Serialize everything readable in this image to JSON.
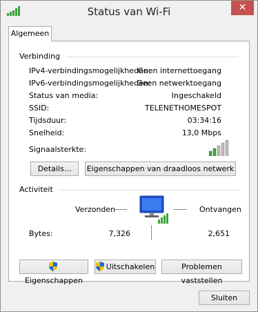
{
  "window": {
    "title": "Status van Wi-Fi",
    "close": "✕"
  },
  "tabs": {
    "general": "Algemeen"
  },
  "connection": {
    "section": "Verbinding",
    "rows": [
      {
        "label": "IPv4-verbindingsmogelijkheden:",
        "value": "Geen internettoegang"
      },
      {
        "label": "IPv6-verbindingsmogelijkheden:",
        "value": "Geen netwerktoegang"
      },
      {
        "label": "Status van media:",
        "value": "Ingeschakeld"
      },
      {
        "label": "SSID:",
        "value": "TELENETHOMESPOT"
      },
      {
        "label": "Tijdsduur:",
        "value": "03:34:16"
      },
      {
        "label": "Snelheid:",
        "value": "13,0 Mbps"
      }
    ],
    "signal_label": "Signaalsterkte:",
    "signal_bars": 5,
    "details_button": "Details...",
    "wireless_props_button": "Eigenschappen van draadloos netwerk"
  },
  "activity": {
    "section": "Activiteit",
    "sent": "Verzonden",
    "received": "Ontvangen",
    "bytes_label": "Bytes:",
    "bytes_sent": "7,326",
    "bytes_received": "2,651"
  },
  "actions": {
    "properties": "Eigenschappen",
    "disable": "Uitschakelen",
    "diagnose": "Problemen vaststellen"
  },
  "footer": {
    "close": "Sluiten"
  }
}
